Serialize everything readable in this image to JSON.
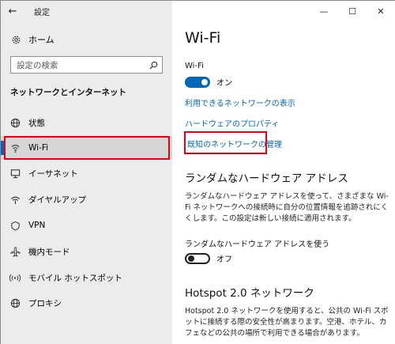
{
  "app": {
    "title": "設定"
  },
  "window_controls": {
    "minimize": "—",
    "maximize": "☐",
    "close": "✕"
  },
  "sidebar": {
    "home_label": "ホーム",
    "search_placeholder": "設定の検索",
    "section_header": "ネットワークとインターネット",
    "items": [
      {
        "label": "状態",
        "icon": "globe-icon"
      },
      {
        "label": "Wi-Fi",
        "icon": "wifi-icon",
        "selected": true
      },
      {
        "label": "イーサネット",
        "icon": "ethernet-icon"
      },
      {
        "label": "ダイヤルアップ",
        "icon": "dialup-icon"
      },
      {
        "label": "VPN",
        "icon": "vpn-icon"
      },
      {
        "label": "機内モード",
        "icon": "airplane-icon"
      },
      {
        "label": "モバイル ホットスポット",
        "icon": "hotspot-icon"
      },
      {
        "label": "プロキシ",
        "icon": "globe-icon"
      }
    ]
  },
  "main": {
    "title": "Wi-Fi",
    "wifi_label": "Wi-Fi",
    "wifi_state": "オン",
    "links": {
      "available_networks": "利用できるネットワークの表示",
      "hardware_properties": "ハードウェアのプロパティ",
      "manage_known": "既知のネットワークの管理"
    },
    "random_hw": {
      "heading": "ランダムなハードウェア アドレス",
      "description": "ランダムなハードウェア アドレスを使って、さまざまな Wi-Fi ネットワークへの接続時に自分の位置情報を追跡されにくくします。この設定は新しい接続に適用されます。",
      "toggle_label": "ランダムなハードウェア アドレスを使う",
      "toggle_state": "オフ"
    },
    "hotspot20": {
      "heading": "Hotspot 2.0 ネットワーク",
      "description": "Hotspot 2.0 ネットワークを使用すると、公共の Wi-Fi スポットに接続する際の安全性が高まります。空港、ホテル、カフェなどの公共の場所で利用できる場合があります。"
    }
  },
  "colors": {
    "accent": "#0067b8",
    "highlight": "#e60012",
    "sidebar_bg": "#ececec"
  }
}
